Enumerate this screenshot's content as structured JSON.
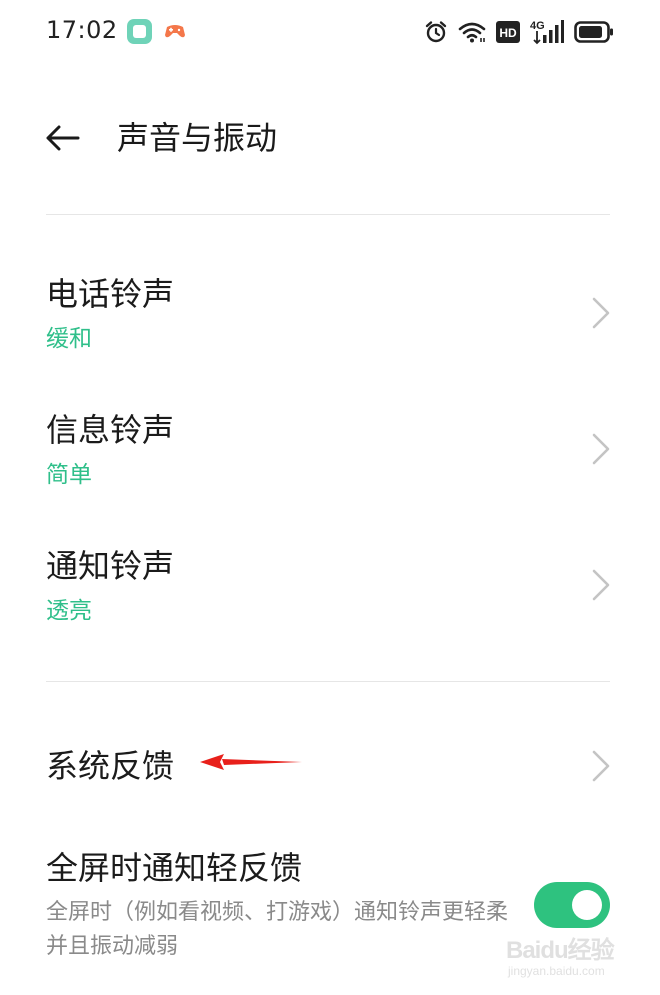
{
  "status_bar": {
    "time": "17:02",
    "icons": [
      "app-notification-icon",
      "game-controller-icon",
      "alarm-icon",
      "wifi-icon",
      "hd-icon",
      "4g-signal-icon",
      "battery-icon"
    ],
    "hd_label": "HD",
    "network_label": "4G"
  },
  "header": {
    "title": "声音与振动",
    "back_icon": "arrow-left-icon"
  },
  "ringtones": [
    {
      "title": "电话铃声",
      "value": "缓和"
    },
    {
      "title": "信息铃声",
      "value": "简单"
    },
    {
      "title": "通知铃声",
      "value": "透亮"
    }
  ],
  "feedback": {
    "system_feedback_label": "系统反馈",
    "fullscreen_title": "全屏时通知轻反馈",
    "fullscreen_desc": "全屏时（例如看视频、打游戏）通知铃声更轻柔并且振动减弱",
    "fullscreen_enabled": true
  },
  "colors": {
    "accent": "#2fbf8a",
    "toggle_on": "#2ec27f",
    "annotation_arrow": "#e8201b"
  },
  "watermark": {
    "line1": "Baidu经验",
    "line2": "jingyan.baidu.com"
  }
}
